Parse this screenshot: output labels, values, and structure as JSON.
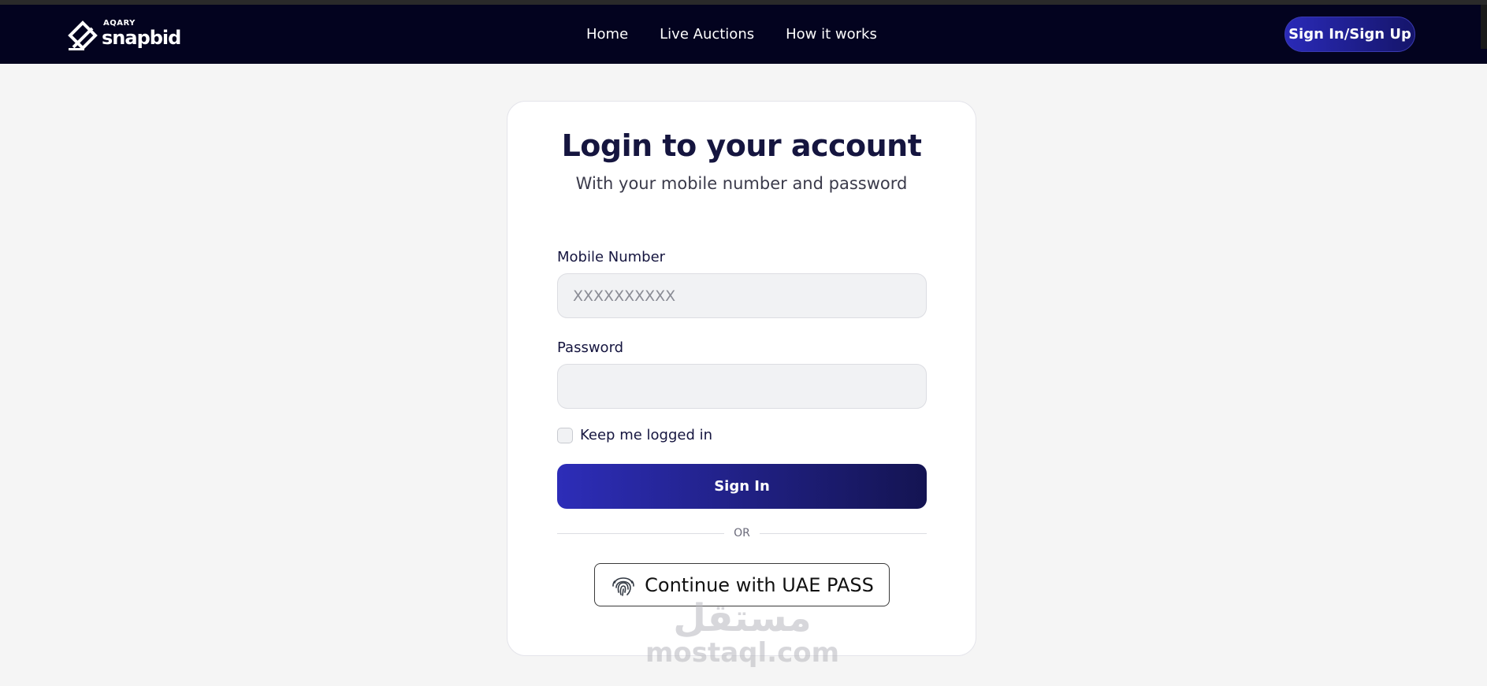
{
  "nav": {
    "logo_small": "AQARY",
    "logo_big": "snapbid",
    "links": [
      "Home",
      "Live Auctions",
      "How it works"
    ],
    "signin_label": "Sign In/Sign Up"
  },
  "login": {
    "title": "Login to your account",
    "subtitle": "With your mobile number and password",
    "mobile_label": "Mobile Number",
    "mobile_placeholder": "XXXXXXXXXX",
    "password_label": "Password",
    "password_value": "",
    "remember_label": "Keep me logged in",
    "remember_checked": false,
    "signin_button": "Sign In",
    "or_text": "OR",
    "uae_pass_button": "Continue with UAE PASS"
  },
  "watermark": {
    "arabic": "مستقل",
    "latin": "mostaql.com"
  },
  "colors": {
    "nav_bg": "#03031f",
    "accent_start": "#2d2db8",
    "accent_end": "#141452",
    "page_bg": "#f5f5f5"
  },
  "icons": {
    "logo": "snapbid-logo-icon",
    "uae_pass": "fingerprint-icon"
  }
}
